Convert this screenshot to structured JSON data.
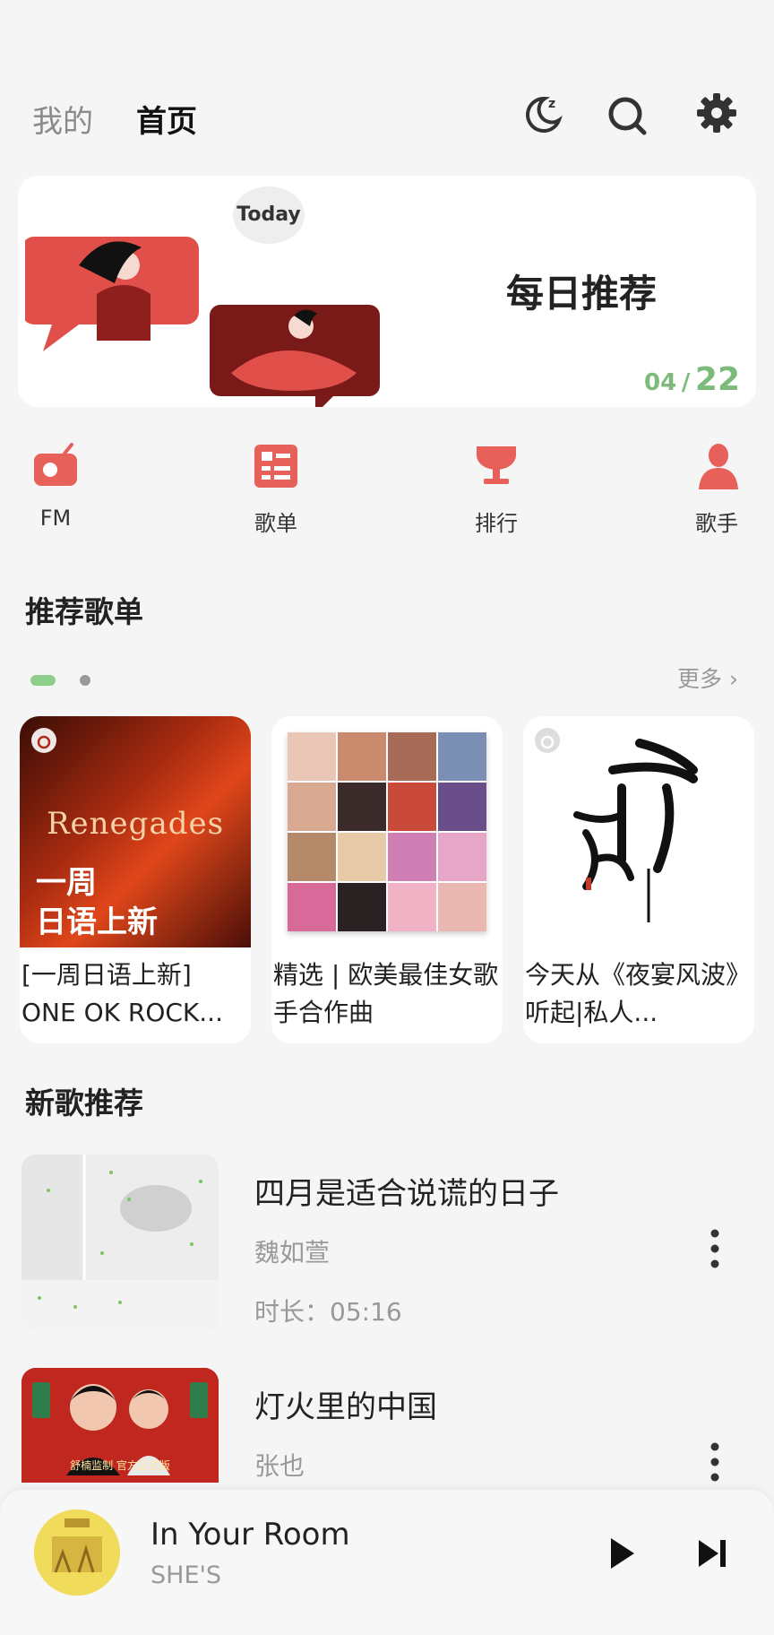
{
  "header": {
    "tab_mine": "我的",
    "tab_home": "首页",
    "icons": [
      "moon-sleep-icon",
      "search-icon",
      "gear-icon"
    ]
  },
  "daily": {
    "today_label": "Today",
    "title": "每日推荐",
    "month": "04",
    "separator": "/",
    "day": "22"
  },
  "nav": [
    {
      "label": "FM",
      "icon": "radio-icon"
    },
    {
      "label": "歌单",
      "icon": "playlist-icon"
    },
    {
      "label": "排行",
      "icon": "trophy-icon"
    },
    {
      "label": "歌手",
      "icon": "person-icon"
    }
  ],
  "playlists": {
    "section_title": "推荐歌单",
    "more_label": "更多",
    "items": [
      {
        "title": "[一周日语上新] ONE OK ROCK...",
        "cover_text_top": "Renegades",
        "cover_text_line1": "一周",
        "cover_text_line2": "日语上新"
      },
      {
        "title": "精选 | 欧美最佳女歌手合作曲"
      },
      {
        "title": "今天从《夜宴风波》听起|私人..."
      }
    ]
  },
  "new_songs": {
    "section_title": "新歌推荐",
    "items": [
      {
        "name": "四月是适合说谎的日子",
        "artist": "魏如萱",
        "duration": "时长：05:16"
      },
      {
        "name": "灯火里的中国",
        "artist": "张也",
        "cover_caption": "舒楠监制 官方正式版"
      }
    ]
  },
  "player": {
    "title": "In Your Room",
    "artist": "SHE'S"
  },
  "colors": {
    "accent_red": "#e8605a",
    "accent_green": "#7dbb7a",
    "background": "#f5f5f5"
  }
}
